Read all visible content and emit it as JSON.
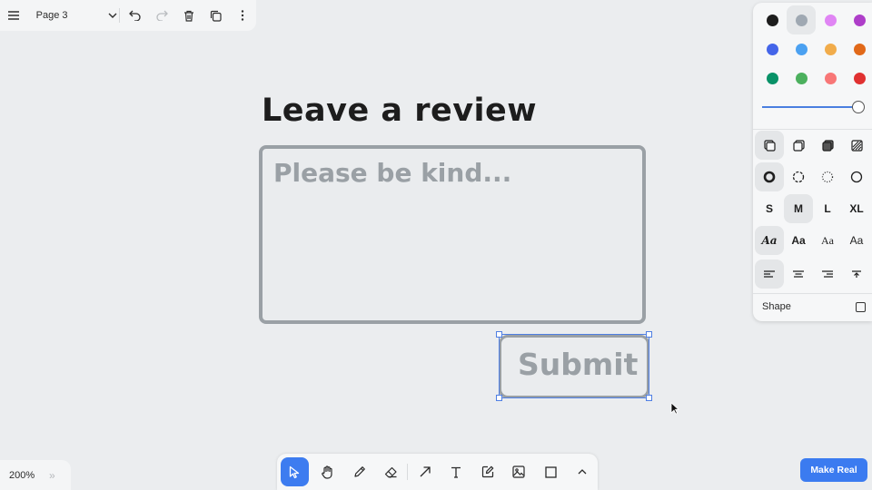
{
  "menu": {
    "page_name": "Page 3"
  },
  "canvas": {
    "title": "Leave a review",
    "review_placeholder": "Please be kind...",
    "submit_label": "Submit"
  },
  "style_panel": {
    "colors": [
      {
        "name": "black",
        "hex": "#1d1d1d",
        "selected": false
      },
      {
        "name": "grey",
        "hex": "#9fa8b2",
        "selected": true
      },
      {
        "name": "light-violet",
        "hex": "#e085f4",
        "selected": false
      },
      {
        "name": "violet",
        "hex": "#ae3ec9",
        "selected": false
      },
      {
        "name": "blue",
        "hex": "#4465e9",
        "selected": false
      },
      {
        "name": "light-blue",
        "hex": "#4ba1f1",
        "selected": false
      },
      {
        "name": "yellow",
        "hex": "#f1ac4b",
        "selected": false
      },
      {
        "name": "orange",
        "hex": "#e16919",
        "selected": false
      },
      {
        "name": "green",
        "hex": "#099268",
        "selected": false
      },
      {
        "name": "light-green",
        "hex": "#4cb05e",
        "selected": false
      },
      {
        "name": "light-red",
        "hex": "#f87777",
        "selected": false
      },
      {
        "name": "red",
        "hex": "#e03131",
        "selected": false
      }
    ],
    "opacity": 1.0,
    "sizes": {
      "s": "S",
      "m": "M",
      "l": "L",
      "xl": "XL"
    },
    "selected_size": "M",
    "fonts": {
      "draw": "Aa",
      "sans": "Aa",
      "serif": "Aa",
      "mono": "Aa"
    },
    "shape_label": "Shape",
    "shape_checked": false
  },
  "zoom": {
    "level": "200%",
    "toggle": "»"
  },
  "make_real": {
    "label": "Make Real"
  },
  "colors": {
    "accent": "#3d7cf0",
    "shape_stroke": "#9aa0a5",
    "canvas_bg": "#ebedef",
    "selection": "#4f7fe3"
  }
}
